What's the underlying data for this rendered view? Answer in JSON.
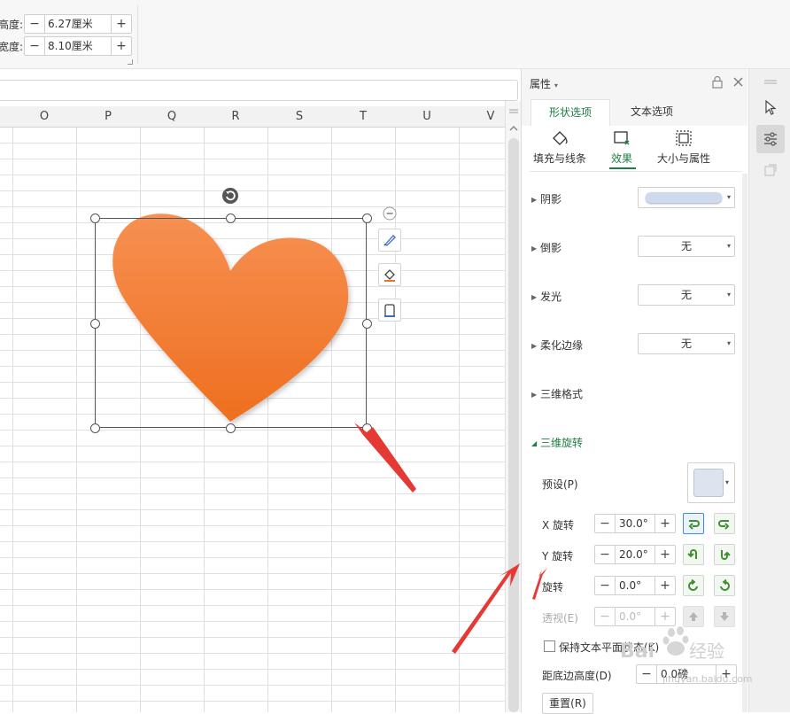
{
  "ribbon": {
    "height_label": "高度:",
    "height_value": "6.27厘米",
    "width_label": "宽度:",
    "width_value": "8.10厘米"
  },
  "sheet": {
    "columns": [
      "O",
      "P",
      "Q",
      "R",
      "S",
      "T",
      "U",
      "V"
    ]
  },
  "pane": {
    "title": "属性",
    "tabs": [
      "形状选项",
      "文本选项"
    ],
    "active_tab": "形状选项",
    "subtabs": [
      "填充与线条",
      "效果",
      "大小与属性"
    ],
    "active_subtab": "效果",
    "sections": {
      "shadow": {
        "label": "阴影"
      },
      "reflection": {
        "label": "倒影",
        "value": "无"
      },
      "glow": {
        "label": "发光",
        "value": "无"
      },
      "soft_edges": {
        "label": "柔化边缘",
        "value": "无"
      },
      "format_3d": {
        "label": "三维格式"
      },
      "rotation_3d": {
        "label": "三维旋转",
        "expanded": true
      }
    },
    "rotation_3d": {
      "preset_label": "预设(P)",
      "x_label": "X 旋转",
      "x_value": "30.0°",
      "y_label": "Y 旋转",
      "y_value": "20.0°",
      "z_label": "旋转",
      "z_value": "0.0°",
      "perspective_label": "透视(E)",
      "perspective_value": "0.0°",
      "keep_flat_label": "保持文本平面状态(K)",
      "distance_label": "距底边高度(D)",
      "distance_value": "0.0磅",
      "reset_label": "重置(R)"
    }
  },
  "shape": {
    "fill_top": "#f79052",
    "fill_bottom": "#ee6f1f"
  },
  "watermark": {
    "text": "Baidu 经验",
    "url": "jingyan.baidu.com"
  },
  "colors": {
    "accent_green": "#1e7d45",
    "annotation_red": "#e53935"
  }
}
